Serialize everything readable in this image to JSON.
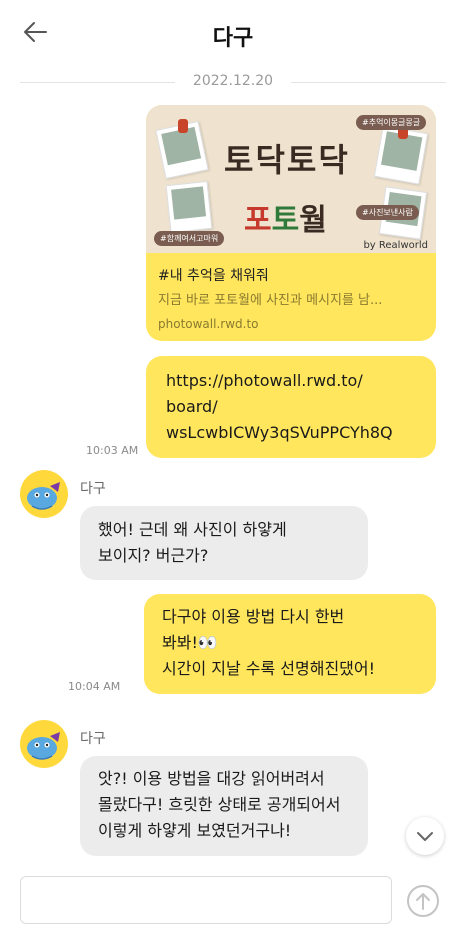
{
  "header": {
    "title": "다구",
    "back_icon": "arrow-left-icon"
  },
  "date_divider": "2022.12.20",
  "messages": {
    "link_card": {
      "preview": {
        "logo_line1": "토닥토닥",
        "logo_line2_part1": "포",
        "logo_line2_part2": "토",
        "logo_line2_part3": "월",
        "tag_top_right": "#추억이몽글몽글",
        "tag_bottom_left": "#함께여서고마워",
        "tag_bottom_right": "#사진보낸사람",
        "byline": "by Realworld"
      },
      "title": "#내 추억을 채워줘",
      "description": "지금 바로 포토월에 사진과 메시지를 남...",
      "domain": "photowall.rwd.to"
    },
    "url_bubble": {
      "lines": [
        "https://photowall.rwd.to/",
        "board/",
        "wsLcwbICWy3qSVuPPCYh8Q"
      ],
      "time": "10:03 AM"
    },
    "reply1": {
      "sender": "다구",
      "lines": [
        "했어! 근데 왜 사진이 하얗게",
        "보이지? 버근가?"
      ]
    },
    "me2": {
      "lines": [
        "다구야 이용 방법 다시 한번",
        "봐봐!👀",
        "시간이 지날 수록 선명해진댔어!"
      ],
      "time": "10:04 AM"
    },
    "reply2": {
      "sender": "다구",
      "lines": [
        "앗?! 이용 방법을 대강 읽어버려서",
        "몰랐다구! 흐릿한 상태로 공개되어서",
        "이렇게 하얗게 보였던거구나!"
      ]
    }
  },
  "composer": {
    "input_value": "",
    "placeholder": "",
    "send_icon": "arrow-up-circle-icon"
  },
  "scroll_button_icon": "chevron-down-icon",
  "colors": {
    "my_bubble": "#ffe65c",
    "their_bubble": "#ececec",
    "avatar_bg": "#ffd93b"
  }
}
